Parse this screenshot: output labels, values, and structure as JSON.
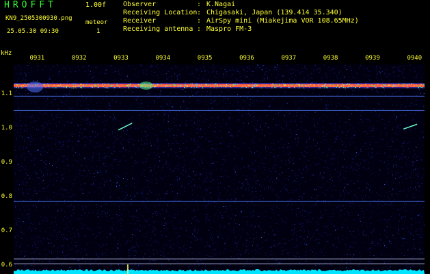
{
  "header": {
    "title": "HROFFT",
    "version": "1.00f",
    "filename": "KN9_2505300930.png",
    "meteor_label": "meteor",
    "datetime": "25.05.30 09:30",
    "meteor_count": "1"
  },
  "metadata": [
    {
      "key": "Observer",
      "value": "K.Nagai"
    },
    {
      "key": "Receiving Location",
      "value": "Chigasaki, Japan (139.414 35.340)"
    },
    {
      "key": "Receiver",
      "value": "AirSpy mini (Miakejima VOR 108.65MHz)"
    },
    {
      "key": "Receiving antenna",
      "value": "Maspro FM-3"
    }
  ],
  "colors": {
    "label": "#ffff33",
    "title": "#33ff33",
    "background": "#000000",
    "noise": "#1a1a8a",
    "carrier": "#ff6644",
    "trace": "#00e5ff"
  },
  "chart_data": {
    "type": "heatmap",
    "unit": "kHz",
    "y_ticks": [
      "1.1",
      "1.0",
      "0.9",
      "0.8",
      "0.7",
      "0.6"
    ],
    "y_values": [
      1.1,
      1.0,
      0.9,
      0.8,
      0.7,
      0.6
    ],
    "ylim": [
      0.574,
      1.187
    ],
    "x_ticks": [
      "0931",
      "0932",
      "0933",
      "0934",
      "0935",
      "0936",
      "0937",
      "0938",
      "0939",
      "0940"
    ],
    "xlim": [
      930.44,
      940.24
    ],
    "carrier_khz": 1.125,
    "lines_khz": [
      1.094,
      1.052,
      0.786,
      0.618,
      0.604
    ],
    "meteors": [
      {
        "time": 933.1,
        "f1": 1.015,
        "f2": 0.995
      },
      {
        "time": 939.9,
        "f1": 1.012,
        "f2": 0.998
      }
    ]
  }
}
